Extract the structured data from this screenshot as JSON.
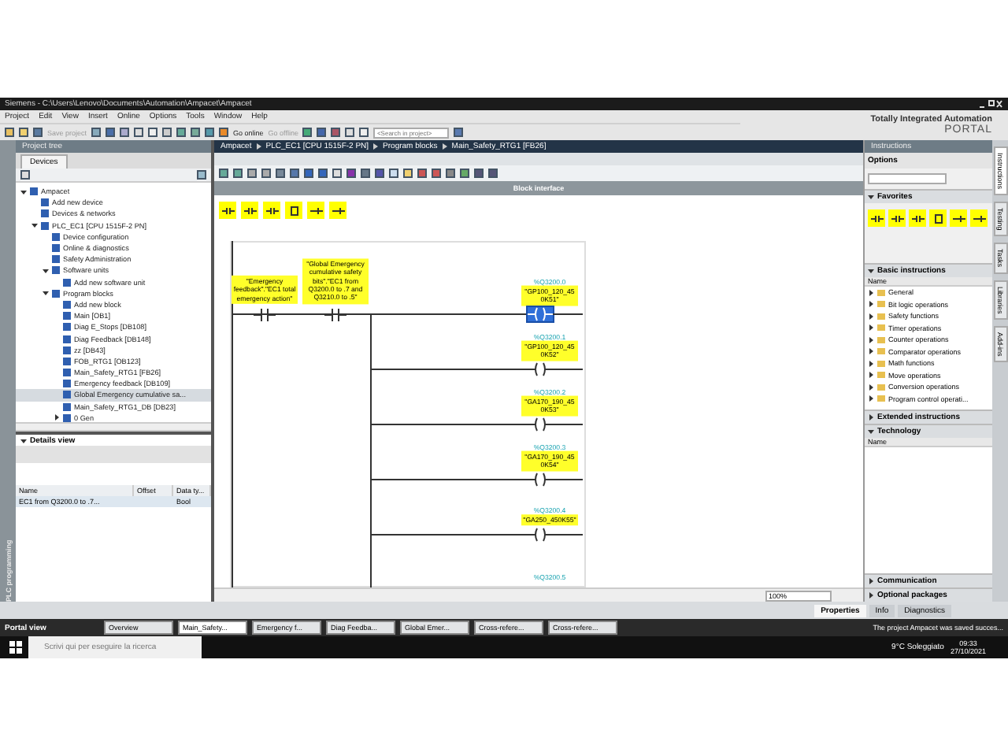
{
  "window": {
    "title": "Siemens  -  C:\\Users\\Lenovo\\Documents\\Automation\\Ampacet\\Ampacet"
  },
  "menu": [
    "Project",
    "Edit",
    "View",
    "Insert",
    "Online",
    "Options",
    "Tools",
    "Window",
    "Help"
  ],
  "toolbar": {
    "save": "Save project",
    "go_online": "Go online",
    "go_offline": "Go offline",
    "search_placeholder": "<Search in project>"
  },
  "branding": {
    "line1": "Totally Integrated Automation",
    "line2": "PORTAL"
  },
  "side_tab": "PLC programming",
  "project_tree": {
    "title": "Project tree",
    "tab": "Devices",
    "items": [
      {
        "label": "Ampacet",
        "selected": false,
        "expanded": true,
        "children": [
          {
            "label": "Add new device",
            "selected": false
          },
          {
            "label": "Devices & networks",
            "selected": false
          },
          {
            "label": "PLC_EC1 [CPU 1515F-2 PN]",
            "selected": false,
            "expanded": true,
            "children": [
              {
                "label": "Device configuration",
                "selected": false
              },
              {
                "label": "Online & diagnostics",
                "selected": false
              },
              {
                "label": "Safety Administration",
                "selected": false
              },
              {
                "label": "Software units",
                "selected": false,
                "expanded": true,
                "children": [
                  {
                    "label": "Add new software unit",
                    "selected": false
                  }
                ]
              },
              {
                "label": "Program blocks",
                "selected": false,
                "expanded": true,
                "children": [
                  {
                    "label": "Add new block",
                    "selected": false
                  },
                  {
                    "label": "Main [OB1]",
                    "selected": false
                  },
                  {
                    "label": "Diag E_Stops [DB108]",
                    "selected": false
                  },
                  {
                    "label": "Diag Feedback [DB148]",
                    "selected": false
                  },
                  {
                    "label": "zz [DB43]",
                    "selected": false
                  },
                  {
                    "label": "FOB_RTG1 [OB123]",
                    "selected": false
                  },
                  {
                    "label": "Main_Safety_RTG1 [FB26]",
                    "selected": false
                  },
                  {
                    "label": "Emergency feedback [DB109]",
                    "selected": false
                  },
                  {
                    "label": "Global Emergency cumulative sa...",
                    "selected": true
                  },
                  {
                    "label": "Main_Safety_RTG1_DB [DB23]",
                    "selected": false
                  },
                  {
                    "label": "0 Gen",
                    "selected": false,
                    "expanded": false
                  }
                ]
              }
            ]
          }
        ]
      }
    ]
  },
  "details_view": {
    "title": "Details view",
    "columns": [
      "Name",
      "Offset",
      "Data ty..."
    ],
    "rows": [
      {
        "name": "EC1 from Q3200.0 to .7...",
        "type": "Bool"
      }
    ]
  },
  "editor": {
    "breadcrumb": [
      "Ampacet",
      "PLC_EC1 [CPU 1515F-2 PN]",
      "Program blocks",
      "Main_Safety_RTG1 [FB26]"
    ],
    "interface_label": "Block interface",
    "contacts": [
      {
        "tag": "\"Emergency feedback\".\"EC1 total emergency action\""
      },
      {
        "tag": "\"Global Emergency cumulative safety bits\".\"EC1 from Q3200.0 to .7 and Q3210.0 to .5\""
      }
    ],
    "coils": [
      {
        "address": "%Q3200.0",
        "tag": "\"GP100_120_450K51\"",
        "selected": true
      },
      {
        "address": "%Q3200.1",
        "tag": "\"GP100_120_450K52\"",
        "selected": false
      },
      {
        "address": "%Q3200.2",
        "tag": "\"GA170_190_450K53\"",
        "selected": false
      },
      {
        "address": "%Q3200.3",
        "tag": "\"GA170_190_450K54\"",
        "selected": false
      },
      {
        "address": "%Q3200.4",
        "tag": "\"GA250_450K55\"",
        "selected": false
      },
      {
        "address": "%Q3200.5"
      }
    ],
    "zoom": "100%"
  },
  "inspector_tabs": [
    {
      "label": "Properties",
      "selected": true
    },
    {
      "label": "Info",
      "selected": false
    },
    {
      "label": "Diagnostics",
      "selected": false
    }
  ],
  "instructions": {
    "title": "Instructions",
    "options": "Options",
    "sections": [
      {
        "kind": "favorites",
        "title": "Favorites",
        "expanded": true
      },
      {
        "kind": "list",
        "title": "Basic instructions",
        "expanded": true,
        "column": "Name",
        "items": [
          "General",
          "Bit logic operations",
          "Safety functions",
          "Timer operations",
          "Counter operations",
          "Comparator operations",
          "Math functions",
          "Move operations",
          "Conversion operations",
          "Program control operati..."
        ]
      },
      {
        "kind": "header",
        "title": "Extended instructions",
        "expanded": false
      },
      {
        "kind": "table",
        "title": "Technology",
        "expanded": true,
        "column": "Name"
      },
      {
        "kind": "header",
        "title": "Communication",
        "expanded": false
      },
      {
        "kind": "header",
        "title": "Optional packages",
        "expanded": false
      }
    ]
  },
  "right_tabs": [
    {
      "label": "Instructions",
      "selected": true
    },
    {
      "label": "Testing",
      "selected": false
    },
    {
      "label": "Tasks",
      "selected": false
    },
    {
      "label": "Libraries",
      "selected": false
    },
    {
      "label": "Add-ins",
      "selected": false
    }
  ],
  "portal_bar": {
    "portal_view": "Portal view",
    "tabs": [
      {
        "label": "Overview",
        "selected": false
      },
      {
        "label": "Main_Safety...",
        "selected": true
      },
      {
        "label": "Emergency f...",
        "selected": false
      },
      {
        "label": "Diag Feedba...",
        "selected": false
      },
      {
        "label": "Global Emer...",
        "selected": false
      },
      {
        "label": "Cross-refere...",
        "selected": false
      },
      {
        "label": "Cross-refere...",
        "selected": false
      }
    ],
    "status": "The project Ampacet was saved succes..."
  },
  "taskbar": {
    "search_placeholder": "Scrivi qui per eseguire la ricerca",
    "weather": "9°C Soleggiato",
    "time": "09:33",
    "date": "27/10/2021"
  }
}
